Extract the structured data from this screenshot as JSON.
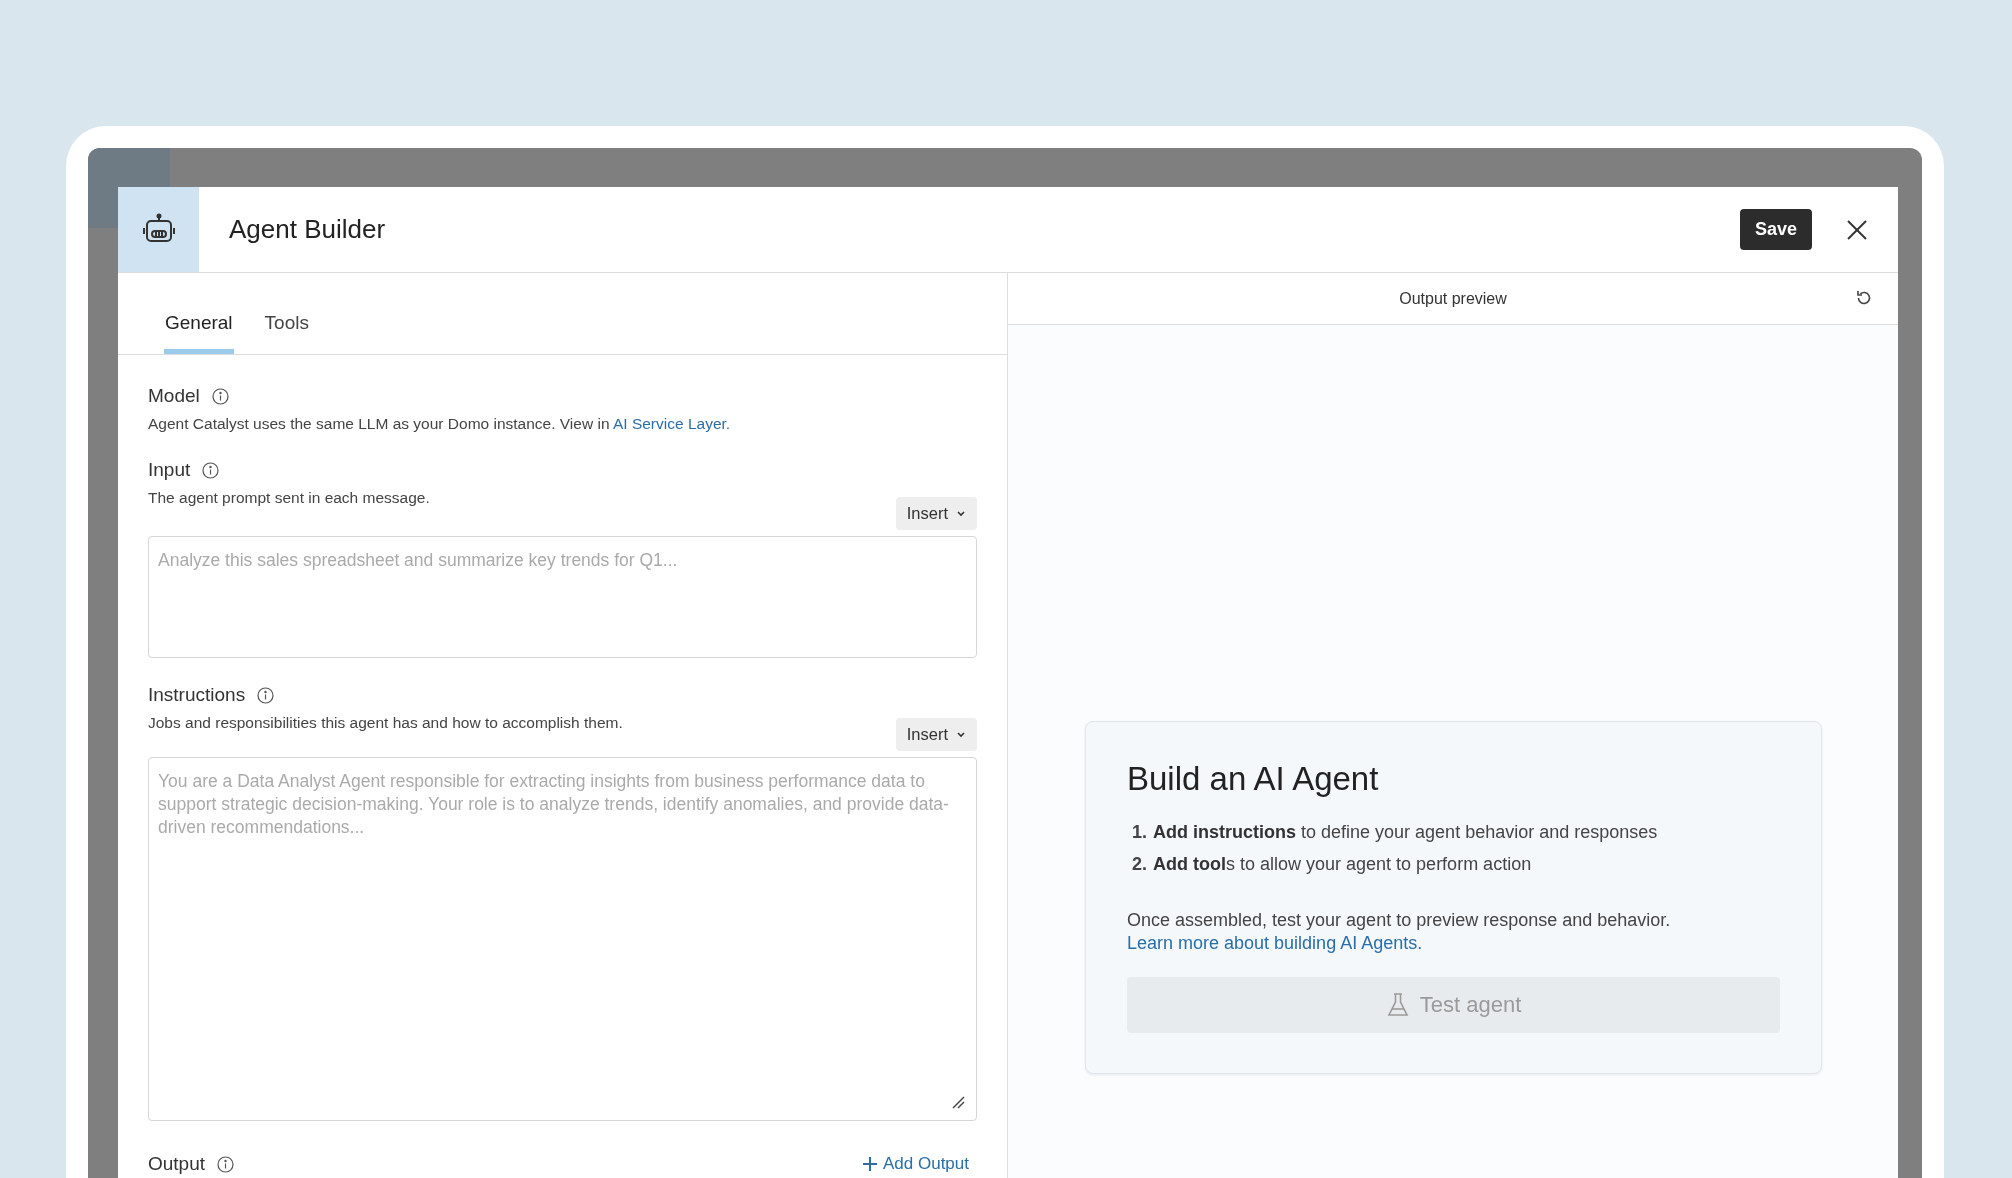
{
  "modal": {
    "title": "Agent Builder",
    "save": "Save"
  },
  "tabs": [
    {
      "label": "General",
      "selected": true
    },
    {
      "label": "Tools",
      "selected": false
    }
  ],
  "form": {
    "model": {
      "label": "Model",
      "description": "Agent Catalyst uses the same LLM as your Domo instance. View in ",
      "link": "AI Service Layer."
    },
    "input": {
      "label": "Input",
      "description": "The agent prompt sent in each message.",
      "insert": "Insert",
      "placeholder": "Analyze this sales spreadsheet and summarize key trends for Q1..."
    },
    "instructions": {
      "label": "Instructions",
      "description": "Jobs and responsibilities this agent has and how to accomplish them.",
      "insert": "Insert",
      "placeholder": "You are a Data Analyst Agent responsible for extracting insights from business performance data to support strategic decision-making. Your role is to analyze trends, identify anomalies, and provide data-driven recommendations..."
    },
    "output": {
      "label": "Output",
      "add": "Add Output"
    }
  },
  "preview": {
    "title": "Output preview",
    "card": {
      "heading": "Build an AI Agent",
      "steps": [
        {
          "number": "1.",
          "text": "**Add instructions** to define your agent behavior and responses"
        },
        {
          "number": "2.",
          "text": "**Add tool**s to allow your agent to perform action"
        }
      ],
      "note": "Once assembled, test your agent to preview response and behavior. ",
      "link": "Learn more about building AI Agents.",
      "button": "Test agent",
      "button_disabled": true
    }
  }
}
